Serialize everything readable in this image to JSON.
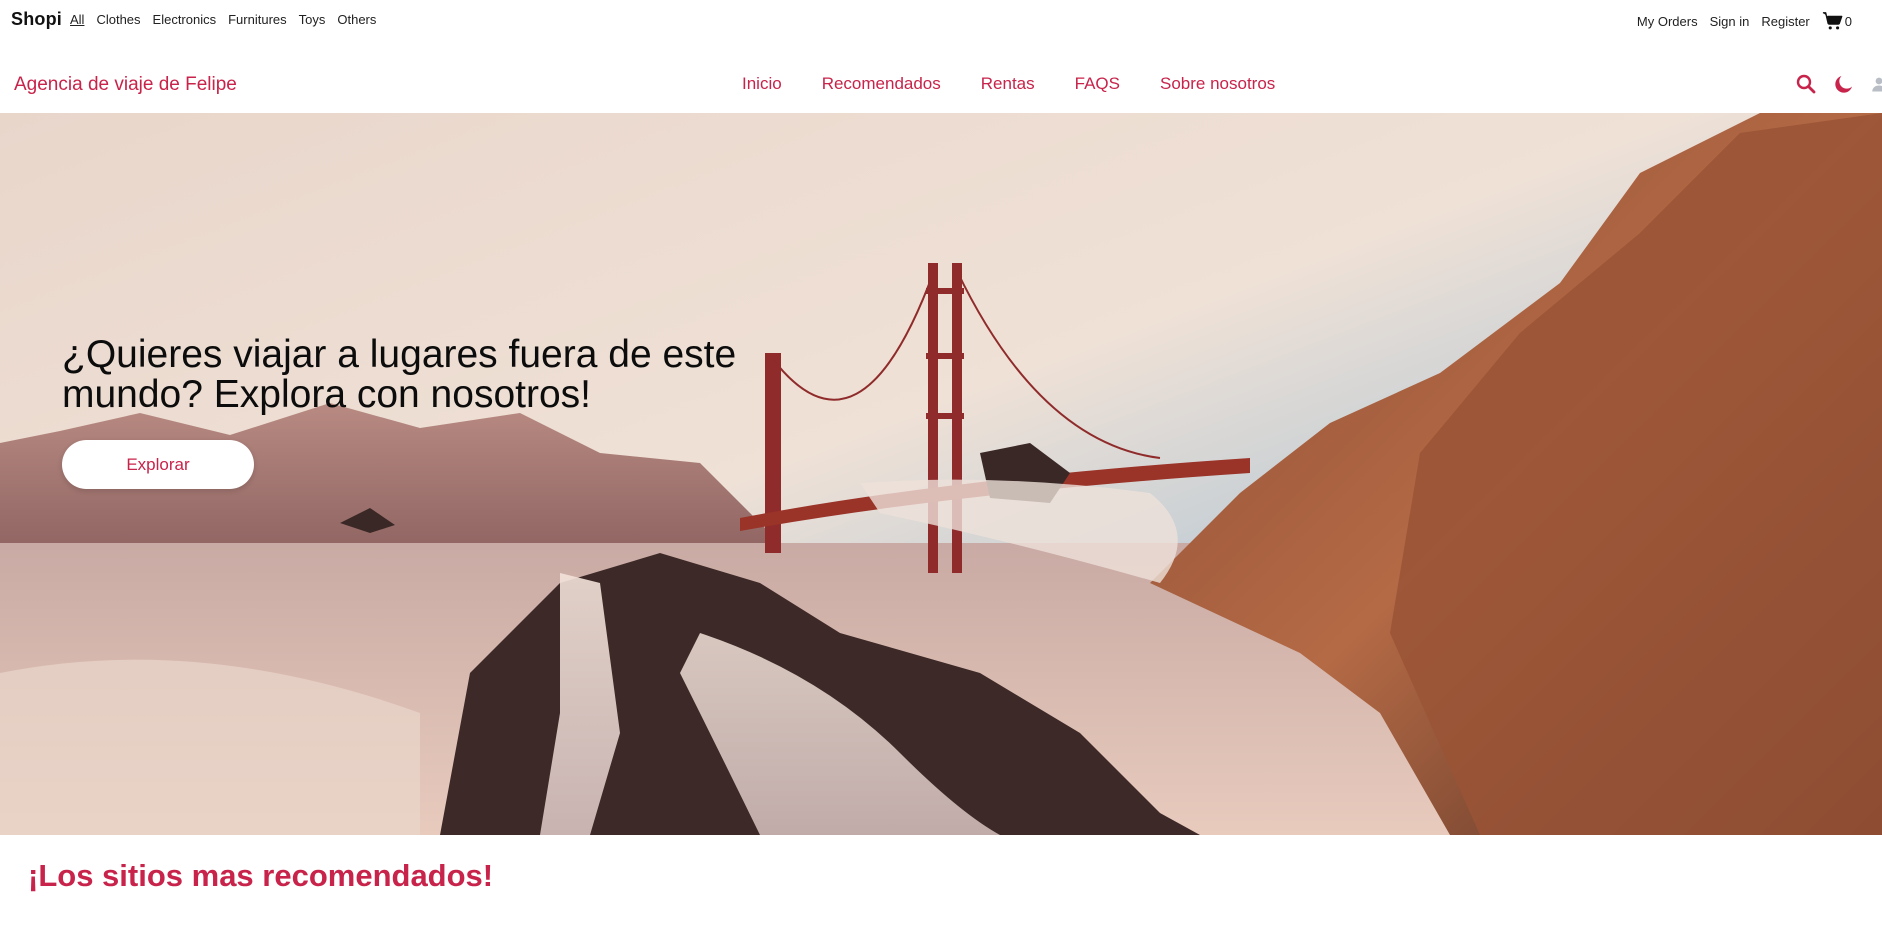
{
  "topbar": {
    "brand": "Shopi",
    "categories": [
      "All",
      "Clothes",
      "Electronics",
      "Furnitures",
      "Toys",
      "Others"
    ],
    "active_category": "All",
    "my_orders": "My Orders",
    "sign_in": "Sign in",
    "register": "Register",
    "cart_count": "0"
  },
  "nav": {
    "agency_name": "Agencia de viaje de Felipe",
    "items": [
      "Inicio",
      "Recomendados",
      "Rentas",
      "FAQS",
      "Sobre nosotros"
    ],
    "icons": [
      "search-icon",
      "moon-icon",
      "user-icon"
    ]
  },
  "hero": {
    "title": "¿Quieres viajar a lugares fuera de este mundo? Explora con nosotros!",
    "button_label": "Explorar"
  },
  "section": {
    "title": "¡Los sitios mas recomendados!"
  },
  "colors": {
    "accent": "#c8234a"
  }
}
